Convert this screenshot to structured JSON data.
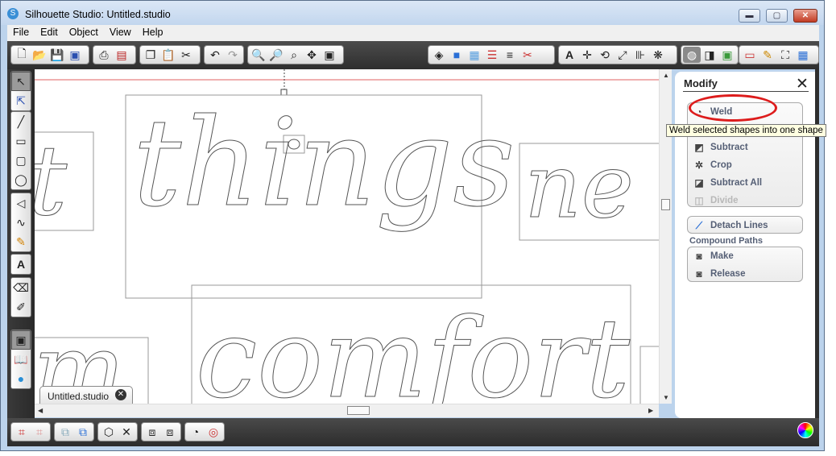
{
  "window": {
    "title": "Silhouette Studio: Untitled.studio",
    "controls": [
      "minimize-icon",
      "maximize-icon",
      "close-icon"
    ]
  },
  "menu": [
    "File",
    "Edit",
    "Object",
    "View",
    "Help"
  ],
  "toolbar_icons": {
    "file": [
      "new-document-icon",
      "open-folder-icon",
      "save-icon",
      "save-to-sd-icon"
    ],
    "print": [
      "print-icon",
      "send-to-cutter-icon"
    ],
    "clipboard": [
      "copy-icon",
      "paste-icon",
      "cut-icon"
    ],
    "history": [
      "undo-icon",
      "redo-icon"
    ],
    "zoom": [
      "zoom-in-icon",
      "zoom-out-icon",
      "zoom-select-icon",
      "pan-icon",
      "fit-to-page-icon"
    ],
    "style": [
      "fill-icon",
      "fill-color-icon",
      "fill-pattern-icon",
      "line-color-icon",
      "line-style-icon",
      "cut-style-icon"
    ],
    "transform": [
      "text-style-icon",
      "move-icon",
      "rotate-icon",
      "scale-icon",
      "align-icon",
      "replicate-icon"
    ],
    "panels": [
      "modify-panel-icon",
      "offset-panel-icon",
      "trace-panel-icon",
      "page-settings-icon",
      "sketch-icon",
      "fullscreen-icon",
      "grid-icon"
    ]
  },
  "left_tools": [
    "select-tool-icon",
    "point-edit-tool-icon",
    "line-tool-icon",
    "rectangle-tool-icon",
    "rounded-rectangle-tool-icon",
    "ellipse-tool-icon",
    "polygon-tool-icon",
    "curve-tool-icon",
    "freehand-tool-icon",
    "text-tool-icon",
    "eraser-tool-icon",
    "knife-tool-icon",
    "library-toggle-icon",
    "book-icon",
    "silhouette-store-icon"
  ],
  "canvas": {
    "words": [
      "things",
      "comfort"
    ],
    "partial_words": [
      "t",
      "ne",
      "m"
    ]
  },
  "document_tab": {
    "label": "Untitled.studio",
    "close": "✕"
  },
  "modify_panel": {
    "title": "Modify",
    "close": "✕",
    "group1": [
      {
        "label": "Weld",
        "icon": "weld-icon",
        "enabled": true
      },
      {
        "label": "Subtract",
        "icon": "subtract-icon",
        "enabled": true
      },
      {
        "label": "Crop",
        "icon": "crop-icon",
        "enabled": true
      },
      {
        "label": "Subtract All",
        "icon": "subtract-all-icon",
        "enabled": true
      },
      {
        "label": "Divide",
        "icon": "divide-icon",
        "enabled": false
      }
    ],
    "detach_lines": "Detach Lines",
    "compound_header": "Compound Paths",
    "compound": [
      {
        "label": "Make",
        "icon": "compound-make-icon"
      },
      {
        "label": "Release",
        "icon": "compound-release-icon"
      }
    ]
  },
  "tooltip": "Weld selected shapes into one shape",
  "bottom_icons": [
    "group-icon",
    "ungroup-icon",
    "make-compound-icon",
    "release-compound-icon",
    "weld-shortcut-icon",
    "delete-icon",
    "bring-to-front-icon",
    "send-to-back-icon",
    "weld-bottom-icon",
    "offset-bottom-icon"
  ],
  "colors": {
    "accent_red": "#dd1c1c",
    "chrome_dark": "#2e2e2e",
    "window_frame": "#bcd3ec"
  }
}
